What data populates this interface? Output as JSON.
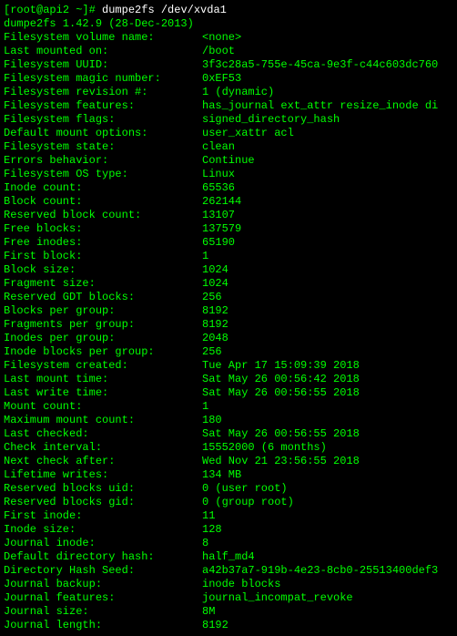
{
  "prompt": {
    "user_host": "root@api2",
    "cwd": "~",
    "command": "dumpe2fs /dev/xvda1"
  },
  "version_line": "dumpe2fs 1.42.9 (28-Dec-2013)",
  "rows": [
    {
      "label": "Filesystem volume name:",
      "value": "<none>"
    },
    {
      "label": "Last mounted on:",
      "value": "/boot"
    },
    {
      "label": "Filesystem UUID:",
      "value": "3f3c28a5-755e-45ca-9e3f-c44c603dc760"
    },
    {
      "label": "Filesystem magic number:",
      "value": "0xEF53"
    },
    {
      "label": "Filesystem revision #:",
      "value": "1 (dynamic)"
    },
    {
      "label": "Filesystem features:",
      "value": "has_journal ext_attr resize_inode di"
    },
    {
      "label": "Filesystem flags:",
      "value": "signed_directory_hash"
    },
    {
      "label": "Default mount options:",
      "value": "user_xattr acl"
    },
    {
      "label": "Filesystem state:",
      "value": "clean"
    },
    {
      "label": "Errors behavior:",
      "value": "Continue"
    },
    {
      "label": "Filesystem OS type:",
      "value": "Linux"
    },
    {
      "label": "Inode count:",
      "value": "65536"
    },
    {
      "label": "Block count:",
      "value": "262144"
    },
    {
      "label": "Reserved block count:",
      "value": "13107"
    },
    {
      "label": "Free blocks:",
      "value": "137579"
    },
    {
      "label": "Free inodes:",
      "value": "65190"
    },
    {
      "label": "First block:",
      "value": "1"
    },
    {
      "label": "Block size:",
      "value": "1024"
    },
    {
      "label": "Fragment size:",
      "value": "1024"
    },
    {
      "label": "Reserved GDT blocks:",
      "value": "256"
    },
    {
      "label": "Blocks per group:",
      "value": "8192"
    },
    {
      "label": "Fragments per group:",
      "value": "8192"
    },
    {
      "label": "Inodes per group:",
      "value": "2048"
    },
    {
      "label": "Inode blocks per group:",
      "value": "256"
    },
    {
      "label": "Filesystem created:",
      "value": "Tue Apr 17 15:09:39 2018"
    },
    {
      "label": "Last mount time:",
      "value": "Sat May 26 00:56:42 2018"
    },
    {
      "label": "Last write time:",
      "value": "Sat May 26 00:56:55 2018"
    },
    {
      "label": "Mount count:",
      "value": "1"
    },
    {
      "label": "Maximum mount count:",
      "value": "180"
    },
    {
      "label": "Last checked:",
      "value": "Sat May 26 00:56:55 2018"
    },
    {
      "label": "Check interval:",
      "value": "15552000 (6 months)"
    },
    {
      "label": "Next check after:",
      "value": "Wed Nov 21 23:56:55 2018"
    },
    {
      "label": "Lifetime writes:",
      "value": "134 MB"
    },
    {
      "label": "Reserved blocks uid:",
      "value": "0 (user root)"
    },
    {
      "label": "Reserved blocks gid:",
      "value": "0 (group root)"
    },
    {
      "label": "First inode:",
      "value": "11"
    },
    {
      "label": "Inode size:",
      "value": "128"
    },
    {
      "label": "Journal inode:",
      "value": "8"
    },
    {
      "label": "Default directory hash:",
      "value": "half_md4"
    },
    {
      "label": "Directory Hash Seed:",
      "value": "a42b37a7-919b-4e23-8cb0-25513400def3"
    },
    {
      "label": "Journal backup:",
      "value": "inode blocks"
    },
    {
      "label": "Journal features:",
      "value": "journal_incompat_revoke"
    },
    {
      "label": "Journal size:",
      "value": "8M"
    },
    {
      "label": "Journal length:",
      "value": "8192"
    }
  ]
}
